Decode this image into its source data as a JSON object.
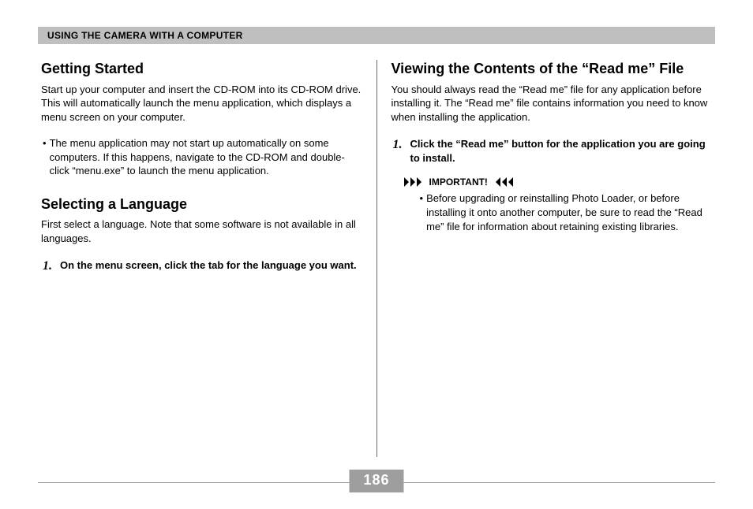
{
  "header": {
    "title": "USING THE CAMERA WITH A COMPUTER"
  },
  "left": {
    "section1": {
      "heading": "Getting Started",
      "para": "Start up your computer and insert the CD-ROM into its CD-ROM drive. This will automatically launch the menu application, which displays a menu screen on your computer.",
      "bullet1": "The menu application may not start up automatically on some computers. If this happens, navigate to the CD-ROM and double-click “menu.exe” to launch the menu application."
    },
    "section2": {
      "heading": "Selecting a Language",
      "para": "First select a language. Note that some software is not available in all languages.",
      "step_num": "1.",
      "step_text": "On the menu screen, click the tab for the language you want."
    }
  },
  "right": {
    "section1": {
      "heading": "Viewing the Contents of the “Read me” File",
      "para": "You should always read the “Read me” file for any application before installing it. The “Read me” file contains information you need to know when installing the application.",
      "step_num": "1.",
      "step_text": "Click the “Read me” button for the application you are going to install.",
      "important_label": "IMPORTANT!",
      "important_bullet": "Before upgrading or reinstalling Photo Loader, or before installing it onto another computer, be sure to read the “Read me” file for information about retaining existing libraries."
    }
  },
  "page_number": "186"
}
